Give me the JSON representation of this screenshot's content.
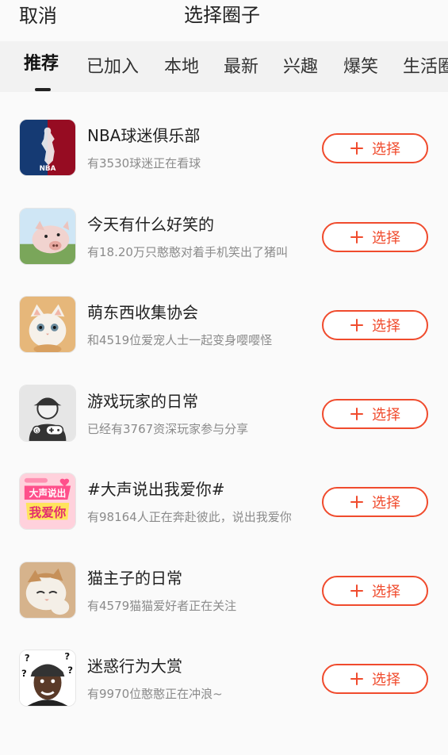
{
  "header": {
    "cancel_label": "取消",
    "title": "选择圈子"
  },
  "tabs": [
    {
      "label": "推荐",
      "active": true
    },
    {
      "label": "已加入"
    },
    {
      "label": "本地"
    },
    {
      "label": "最新"
    },
    {
      "label": "兴趣"
    },
    {
      "label": "爆笑"
    },
    {
      "label": "生活圈"
    }
  ],
  "button_label": "选择",
  "accent_color": "#f04b2d",
  "circles": [
    {
      "name": "NBA球迷俱乐部",
      "desc": "有3530球迷正在看球",
      "avatar": "nba-logo-icon",
      "avatar_text": "NBA"
    },
    {
      "name": "今天有什么好笑的",
      "desc": "有18.20万只憨憨对着手机笑出了猪叫",
      "avatar": "pig-photo-icon"
    },
    {
      "name": "萌东西收集协会",
      "desc": "和4519位爱宠人士一起变身嘤嘤怪",
      "avatar": "kitten-photo-icon"
    },
    {
      "name": "游戏玩家的日常",
      "desc": "已经有3767资深玩家参与分享",
      "avatar": "gamer-icon"
    },
    {
      "name": "#大声说出我爱你#",
      "desc": "有98164人正在奔赴彼此，说出我爱你",
      "avatar": "love-banner-icon",
      "avatar_text_top": "大声说出",
      "avatar_text_bottom": "我爱你"
    },
    {
      "name": "猫主子的日常",
      "desc": "有4579猫猫爱好者正在关注",
      "avatar": "cat-photo-icon"
    },
    {
      "name": "迷惑行为大赏",
      "desc": "有9970位憨憨正在冲浪~",
      "avatar": "confused-man-icon"
    }
  ]
}
